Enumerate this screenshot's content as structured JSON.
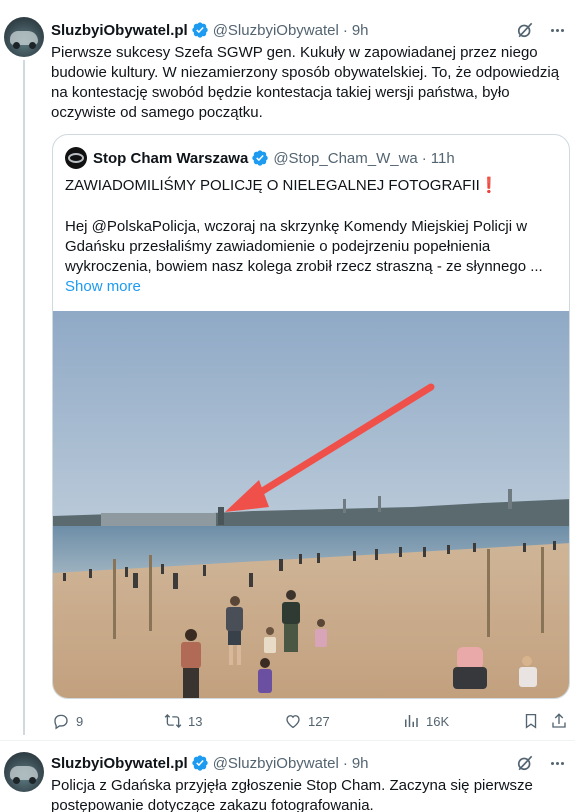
{
  "tweet1": {
    "author_name": "SluzbyiObywatel.pl",
    "author_handle": "@SluzbyiObywatel",
    "time": "9h",
    "text": "Pierwsze sukcesy Szefa SGWP gen. Kukuły w zapowiadanej przez niego budowie kultury. W niezamierzony sposób obywatelskiej. To, że odpowiedzią na kontestację swobód będzie kontestacja takiej wersji państwa, było oczywiste od samego początku.",
    "quote": {
      "author_name": "Stop Cham Warszawa",
      "author_handle": "@Stop_Cham_W_wa",
      "time": "11h",
      "title": "ZAWIADOMILIŚMY POLICJĘ O NIELEGALNEJ FOTOGRAFII",
      "title_emoji": "❗",
      "body": "Hej @PolskaPolicja, wczoraj na skrzynkę Komendy Miejskiej Policji w Gdańsku przesłaliśmy zawiadomienie o podejrzeniu popełnienia wykroczenia, bowiem nasz kolega zrobił rzecz straszną - ze słynnego ...",
      "show_more": "Show more"
    },
    "stats": {
      "replies": "9",
      "reposts": "13",
      "likes": "127",
      "views": "16K"
    }
  },
  "tweet2": {
    "author_name": "SluzbyiObywatel.pl",
    "author_handle": "@SluzbyiObywatel",
    "time": "9h",
    "text": "Policja z Gdańska przyjęła zgłoszenie Stop Cham. Zaczyna się pierwsze postępowanie dotyczące zakazu fotografowania."
  },
  "colors": {
    "accent": "#1d9bf0",
    "muted": "#536471",
    "arrow": "#f0504a"
  },
  "icons": {
    "verified": "verified-badge-icon",
    "grok": "grok-icon",
    "more": "more-options-icon",
    "reply": "reply-icon",
    "repost": "repost-icon",
    "like": "heart-icon",
    "views": "views-icon",
    "bookmark": "bookmark-icon",
    "share": "share-icon"
  }
}
